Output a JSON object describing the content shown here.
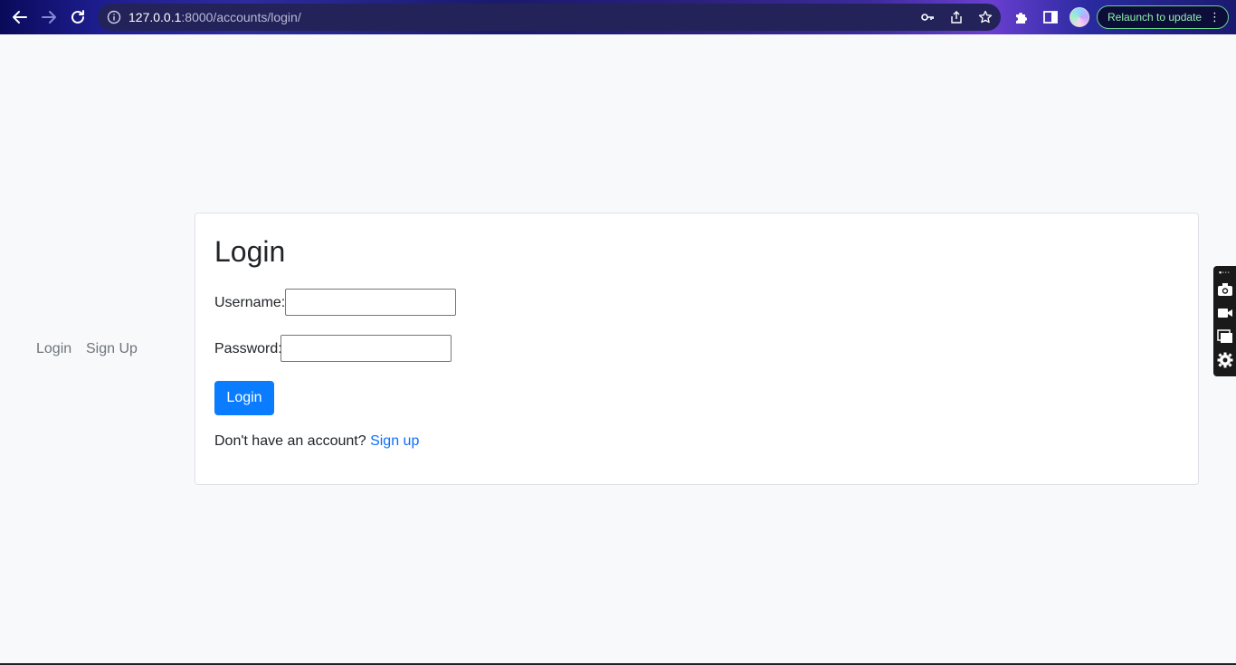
{
  "browser": {
    "url_host": "127.0.0.1",
    "url_rest": ":8000/accounts/login/",
    "relaunch_label": "Relaunch to update",
    "icons": {
      "back": "arrow-left-icon",
      "forward": "arrow-right-icon",
      "reload": "reload-icon",
      "site_info": "info-icon",
      "password": "key-icon",
      "share": "share-icon",
      "bookmark": "star-icon",
      "extensions": "puzzle-icon",
      "side_panel": "side-panel-icon",
      "profile": "avatar",
      "menu": "kebab-menu-icon"
    }
  },
  "sidenav": {
    "items": [
      {
        "label": "Login"
      },
      {
        "label": "Sign Up"
      }
    ]
  },
  "login_card": {
    "title": "Login",
    "username_label": "Username:",
    "username_value": "",
    "password_label": "Password:",
    "password_value": "",
    "submit_label": "Login",
    "account_prompt": "Don't have an account?",
    "signup_link": "Sign up"
  },
  "tool_panel": {
    "icons": [
      "screenshot-camera-icon",
      "video-record-icon",
      "window-capture-icon",
      "settings-gear-icon"
    ]
  },
  "colors": {
    "primary": "#0d6efd",
    "background": "#f8f9fa",
    "muted_text": "#6c757d"
  }
}
